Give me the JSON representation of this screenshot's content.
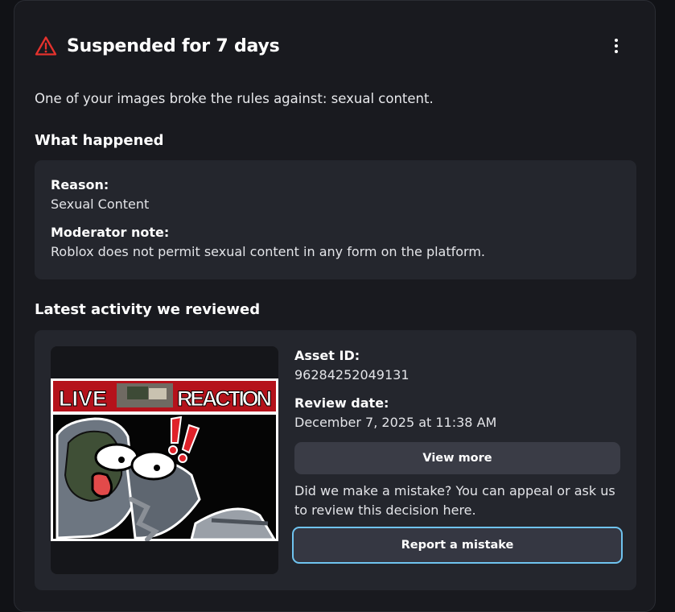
{
  "header": {
    "title": "Suspended for 7 days",
    "icon": "warning-triangle-icon",
    "icon_color": "#e5322d"
  },
  "summary": "One of your images broke the rules against: sexual content.",
  "what_happened": {
    "heading": "What happened",
    "reason_label": "Reason:",
    "reason_value": "Sexual Content",
    "note_label": "Moderator note:",
    "note_value": "Roblox does not permit sexual content in any form on the platform."
  },
  "latest_activity": {
    "heading": "Latest activity we reviewed",
    "thumbnail": {
      "banner_left": "LIVE",
      "banner_right": "REACTION",
      "banner_color": "#b5121b"
    },
    "asset_id_label": "Asset ID:",
    "asset_id_value": "96284252049131",
    "review_date_label": "Review date:",
    "review_date_value": "December 7, 2025 at 11:38 AM",
    "view_more_label": "View more",
    "appeal_text": "Did we make a mistake? You can appeal or ask us to review this decision here.",
    "report_label": "Report a mistake",
    "focus_ring_color": "#6fc3ef"
  }
}
